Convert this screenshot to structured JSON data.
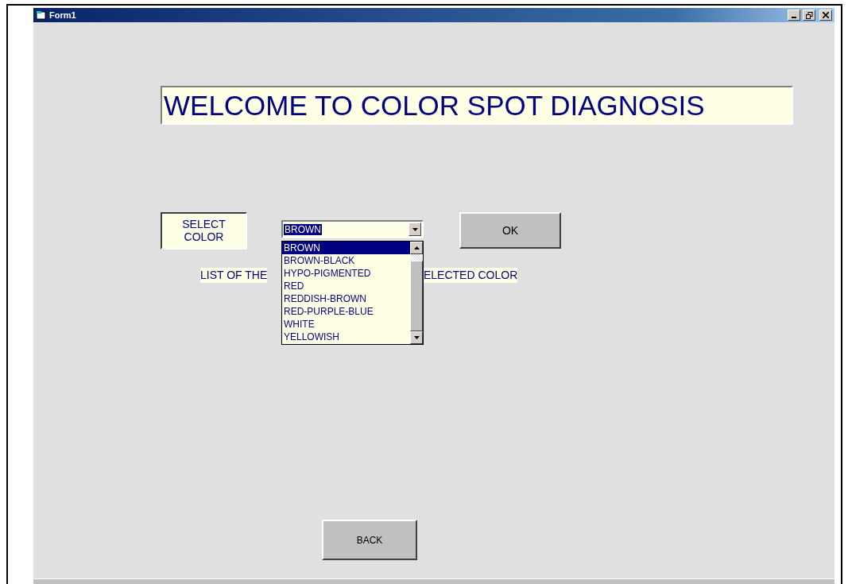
{
  "window": {
    "title": "Form1"
  },
  "heading": "WELCOME TO COLOR SPOT DIAGNOSIS",
  "select_label": "SELECT COLOR",
  "combo": {
    "value": "BROWN",
    "expanded": true,
    "options": [
      {
        "label": "BROWN",
        "selected": true
      },
      {
        "label": "BROWN-BLACK",
        "selected": false
      },
      {
        "label": "HYPO-PIGMENTED",
        "selected": false
      },
      {
        "label": "RED",
        "selected": false
      },
      {
        "label": "REDDISH-BROWN",
        "selected": false
      },
      {
        "label": "RED-PURPLE-BLUE",
        "selected": false
      },
      {
        "label": "WHITE",
        "selected": false
      },
      {
        "label": "YELLOWISH",
        "selected": false
      }
    ]
  },
  "ok_button": "OK",
  "list_label_parts": [
    "LIST OF THE",
    "ELECTED COLOR"
  ],
  "back_button": "BACK"
}
